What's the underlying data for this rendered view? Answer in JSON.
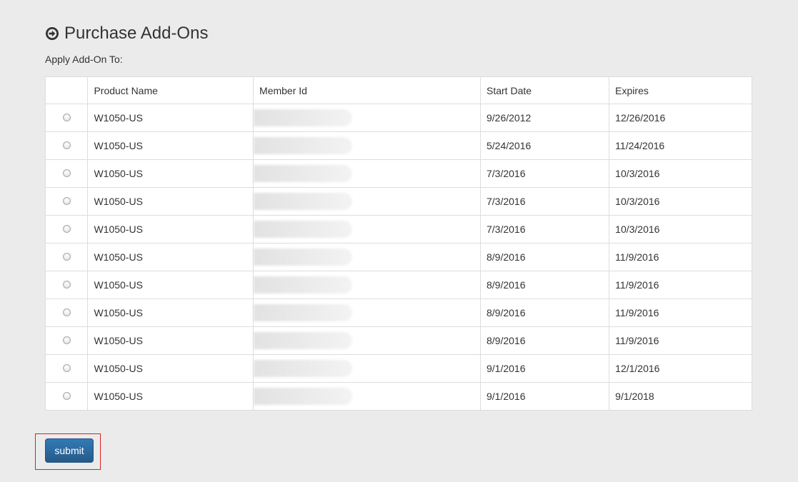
{
  "page": {
    "title": "Purchase Add-Ons",
    "subtitle": "Apply Add-On To:"
  },
  "table": {
    "columns": [
      "",
      "Product Name",
      "Member Id",
      "Start Date",
      "Expires"
    ],
    "rows": [
      {
        "product": "W1050-US",
        "member_id": "",
        "start": "9/26/2012",
        "expires": "12/26/2016"
      },
      {
        "product": "W1050-US",
        "member_id": "",
        "start": "5/24/2016",
        "expires": "11/24/2016"
      },
      {
        "product": "W1050-US",
        "member_id": "",
        "start": "7/3/2016",
        "expires": "10/3/2016"
      },
      {
        "product": "W1050-US",
        "member_id": "",
        "start": "7/3/2016",
        "expires": "10/3/2016"
      },
      {
        "product": "W1050-US",
        "member_id": "",
        "start": "7/3/2016",
        "expires": "10/3/2016"
      },
      {
        "product": "W1050-US",
        "member_id": "",
        "start": "8/9/2016",
        "expires": "11/9/2016"
      },
      {
        "product": "W1050-US",
        "member_id": "",
        "start": "8/9/2016",
        "expires": "11/9/2016"
      },
      {
        "product": "W1050-US",
        "member_id": "",
        "start": "8/9/2016",
        "expires": "11/9/2016"
      },
      {
        "product": "W1050-US",
        "member_id": "",
        "start": "8/9/2016",
        "expires": "11/9/2016"
      },
      {
        "product": "W1050-US",
        "member_id": "",
        "start": "9/1/2016",
        "expires": "12/1/2016"
      },
      {
        "product": "W1050-US",
        "member_id": "",
        "start": "9/1/2016",
        "expires": "9/1/2018"
      }
    ]
  },
  "actions": {
    "submit_label": "submit"
  },
  "icons": {
    "heading_icon": "circle-arrow-right-icon"
  },
  "colors": {
    "background": "#ebebeb",
    "button": "#2d6ca2",
    "highlight": "#e02020"
  }
}
